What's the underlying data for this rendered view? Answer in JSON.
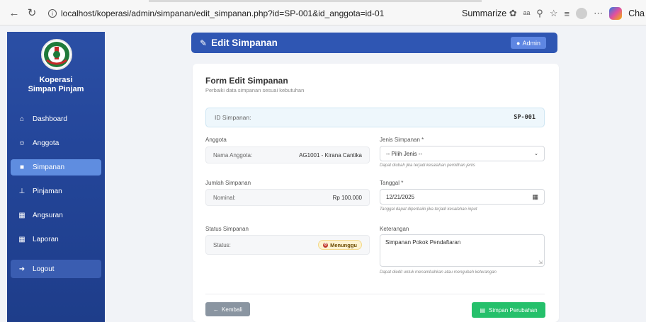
{
  "browser": {
    "url": "localhost/koperasi/admin/simpanan/edit_simpanan.php?id=SP-001&id_anggota=id-01",
    "summarize_label": "Summarize",
    "tab_partial": "Cha"
  },
  "sidebar": {
    "brand_line1": "Koperasi",
    "brand_line2": "Simpan Pinjam",
    "items": [
      {
        "label": "Dashboard",
        "icon": "home-icon"
      },
      {
        "label": "Anggota",
        "icon": "users-icon"
      },
      {
        "label": "Simpanan",
        "icon": "wallet-icon",
        "active": true
      },
      {
        "label": "Pinjaman",
        "icon": "hand-holding-icon"
      },
      {
        "label": "Angsuran",
        "icon": "calendar-icon"
      },
      {
        "label": "Laporan",
        "icon": "calendar-icon"
      }
    ],
    "logout_label": "Logout"
  },
  "header": {
    "title": "Edit Simpanan",
    "admin_label": "Admin"
  },
  "form": {
    "title": "Form Edit Simpanan",
    "subtitle": "Perbaiki data simpanan sesuai kebutuhan",
    "id_label": "ID Simpanan:",
    "id_value": "SP-001",
    "anggota_label": "Anggota",
    "nama_anggota_label": "Nama Anggota:",
    "nama_anggota_value": "AG1001 - Kirana Cantika",
    "jenis_label": "Jenis Simpanan *",
    "jenis_value": "-- Pilih Jenis --",
    "jenis_hint": "Dapat diubah jika terjadi kesalahan pemilihan jenis",
    "jumlah_label": "Jumlah Simpanan",
    "nominal_label": "Nominal:",
    "nominal_value": "Rp 100.000",
    "tanggal_label": "Tanggal *",
    "tanggal_value": "12/21/2025",
    "tanggal_hint": "Tanggal dapat diperbaiki jika terjadi kesalahan input",
    "status_section_label": "Status Simpanan",
    "status_label": "Status:",
    "status_value": "Menunggu",
    "keterangan_label": "Keterangan",
    "keterangan_value": "Simpanan Pokok Pendaftaran",
    "keterangan_hint": "Dapat diedit untuk menambahkan atau mengubah keterangan",
    "back_label": "Kembali",
    "save_label": "Simpan Perubahan"
  },
  "colors": {
    "sidebar": "#24469a",
    "header": "#2f56b3",
    "active_item": "#5f8de0",
    "save_button": "#25c06b",
    "back_button": "#8a95a1",
    "status_badge": "#fdf2d0"
  }
}
